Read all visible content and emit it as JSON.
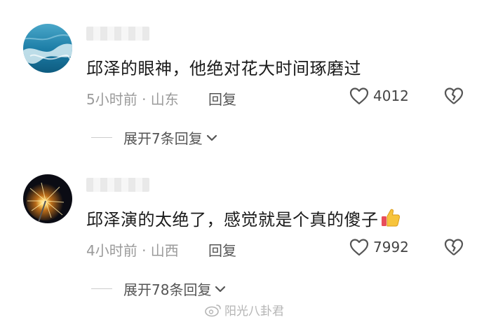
{
  "comments": [
    {
      "text": "邱泽的眼神，他绝对花大时间琢磨过",
      "time_location": "5小时前 · 山东",
      "reply_label": "回复",
      "likes": "4012",
      "expand_label": "展开7条回复",
      "avatar": "ocean-wave-avatar"
    },
    {
      "text": "邱泽演的太绝了，感觉就是个真的傻子",
      "emoji": "thumbs-up-icon",
      "time_location": "4小时前 · 山西",
      "reply_label": "回复",
      "likes": "7992",
      "expand_label": "展开78条回复",
      "avatar": "sparkler-avatar"
    }
  ],
  "watermark": {
    "text": "阳光八卦君",
    "icon": "weibo-icon"
  },
  "colors": {
    "text": "#1a1a1a",
    "meta": "#9a9a9a",
    "action": "#555555"
  }
}
